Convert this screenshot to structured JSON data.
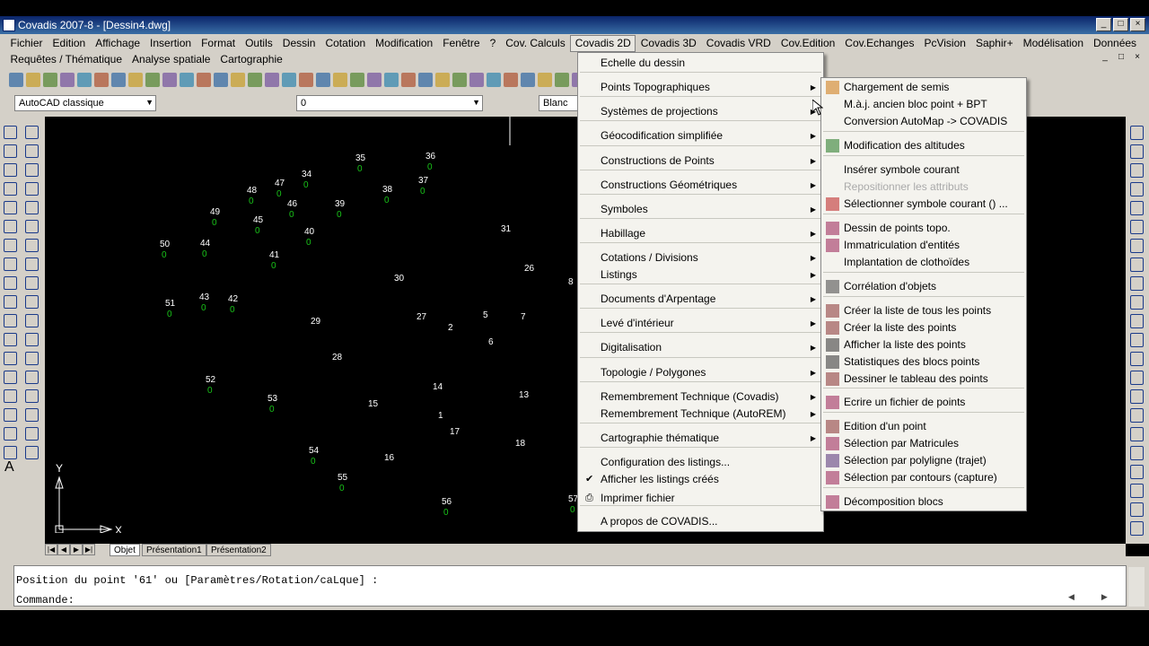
{
  "window": {
    "title": "Covadis 2007-8 - [Dessin4.dwg]",
    "controls": [
      "_",
      "□",
      "×"
    ],
    "mdi_controls": [
      "_",
      "□",
      "×"
    ]
  },
  "menubar": {
    "row1": [
      "Fichier",
      "Edition",
      "Affichage",
      "Insertion",
      "Format",
      "Outils",
      "Dessin",
      "Cotation",
      "Modification",
      "Fenêtre",
      "?",
      "Cov. Calculs",
      "Covadis 2D",
      "Covadis 3D",
      "Covadis VRD",
      "Cov.Edition",
      "Cov.Echanges",
      "PcVision",
      "Saphir+",
      "Modélisation",
      "Données"
    ],
    "row2": [
      "Requêtes / Thématique",
      "Analyse spatiale",
      "Cartographie"
    ],
    "active": "Covadis 2D"
  },
  "toolbar": {
    "workspace": "AutoCAD classique",
    "layer": "0",
    "color": "Blanc"
  },
  "canvas": {
    "points": [
      {
        "label": "35",
        "alt": "0"
      },
      {
        "label": "36",
        "alt": "0"
      },
      {
        "label": "34",
        "alt": "0"
      },
      {
        "label": "47",
        "alt": "0"
      },
      {
        "label": "37",
        "alt": "0"
      },
      {
        "label": "48",
        "alt": "0"
      },
      {
        "label": "38",
        "alt": "0"
      },
      {
        "label": "46",
        "alt": "0"
      },
      {
        "label": "39",
        "alt": "0"
      },
      {
        "label": "49",
        "alt": "0"
      },
      {
        "label": "45",
        "alt": "0"
      },
      {
        "label": "40",
        "alt": "0"
      },
      {
        "label": "31",
        "alt": ""
      },
      {
        "label": "50",
        "alt": "0"
      },
      {
        "label": "44",
        "alt": "0"
      },
      {
        "label": "41",
        "alt": "0"
      },
      {
        "label": "26",
        "alt": ""
      },
      {
        "label": "30",
        "alt": ""
      },
      {
        "label": "8",
        "alt": ""
      },
      {
        "label": "51",
        "alt": "0"
      },
      {
        "label": "43",
        "alt": "0"
      },
      {
        "label": "42",
        "alt": "0"
      },
      {
        "label": "27",
        "alt": ""
      },
      {
        "label": "5",
        "alt": ""
      },
      {
        "label": "7",
        "alt": ""
      },
      {
        "label": "29",
        "alt": ""
      },
      {
        "label": "2",
        "alt": ""
      },
      {
        "label": "6",
        "alt": ""
      },
      {
        "label": "28",
        "alt": ""
      },
      {
        "label": "52",
        "alt": "0"
      },
      {
        "label": "14",
        "alt": ""
      },
      {
        "label": "13",
        "alt": ""
      },
      {
        "label": "53",
        "alt": "0"
      },
      {
        "label": "15",
        "alt": ""
      },
      {
        "label": "1",
        "alt": ""
      },
      {
        "label": "17",
        "alt": ""
      },
      {
        "label": "18",
        "alt": ""
      },
      {
        "label": "54",
        "alt": "0"
      },
      {
        "label": "16",
        "alt": ""
      },
      {
        "label": "55",
        "alt": "0"
      },
      {
        "label": "56",
        "alt": "0"
      },
      {
        "label": "57",
        "alt": "0"
      }
    ],
    "ucs_x": "X",
    "ucs_y": "Y"
  },
  "layout_tabs": [
    "Objet",
    "Présentation1",
    "Présentation2"
  ],
  "command": {
    "line1": "Position du point '61' ou [Paramètres/Rotation/caLque] :",
    "line2": "Commande:"
  },
  "covadis2d_menu": [
    {
      "label": "Echelle du dessin",
      "sub": false
    },
    {
      "label": "Points Topographiques",
      "sub": true
    },
    {
      "label": "Systèmes de projections",
      "sub": true
    },
    {
      "label": "Géocodification simplifiée",
      "sub": true
    },
    {
      "label": "Constructions de Points",
      "sub": true
    },
    {
      "label": "Constructions Géométriques",
      "sub": true
    },
    {
      "label": "Symboles",
      "sub": true
    },
    {
      "label": "Habillage",
      "sub": true
    },
    {
      "label": "Cotations / Divisions",
      "sub": true
    },
    {
      "label": "Listings",
      "sub": true
    },
    {
      "label": "Documents d'Arpentage",
      "sub": true
    },
    {
      "label": "Levé d'intérieur",
      "sub": true
    },
    {
      "label": "Digitalisation",
      "sub": true
    },
    {
      "label": "Topologie / Polygones",
      "sub": true
    },
    {
      "label": "Remembrement Technique (Covadis)",
      "sub": true
    },
    {
      "label": "Remembrement Technique (AutoREM)",
      "sub": true
    },
    {
      "label": "Cartographie thématique",
      "sub": true
    },
    {
      "label": "Configuration des listings...",
      "sub": false
    },
    {
      "label": "Afficher les listings créés",
      "sub": false,
      "checked": true
    },
    {
      "label": "Imprimer fichier",
      "sub": false
    },
    {
      "label": "A propos de COVADIS...",
      "sub": false
    }
  ],
  "points_topo_submenu": [
    {
      "label": "Chargement de semis"
    },
    {
      "label": "M.à.j. ancien bloc point + BPT"
    },
    {
      "label": "Conversion AutoMap -> COVADIS"
    },
    {
      "label": "Modification des altitudes"
    },
    {
      "label": "Insérer symbole courant"
    },
    {
      "label": "Repositionner les attributs",
      "disabled": true
    },
    {
      "label": "Sélectionner symbole courant () ..."
    },
    {
      "label": "Dessin de points topo."
    },
    {
      "label": "Immatriculation d'entités"
    },
    {
      "label": "Implantation de clothoïdes"
    },
    {
      "label": "Corrélation d'objets"
    },
    {
      "label": "Créer la liste de tous les points"
    },
    {
      "label": "Créer la liste des points"
    },
    {
      "label": "Afficher la liste des points"
    },
    {
      "label": "Statistiques des blocs points"
    },
    {
      "label": "Dessiner le tableau des points"
    },
    {
      "label": "Ecrire un fichier de points"
    },
    {
      "label": "Edition d'un point"
    },
    {
      "label": "Sélection par Matricules"
    },
    {
      "label": "Sélection par polyligne (trajet)"
    },
    {
      "label": "Sélection par contours  (capture)"
    },
    {
      "label": "Décomposition blocs"
    }
  ],
  "colors": {
    "point_label": "#ffffff",
    "point_alt": "#19c219",
    "canvas_bg": "#000000",
    "chrome": "#d4d0c8",
    "menu_bg": "#f4f3ee"
  }
}
